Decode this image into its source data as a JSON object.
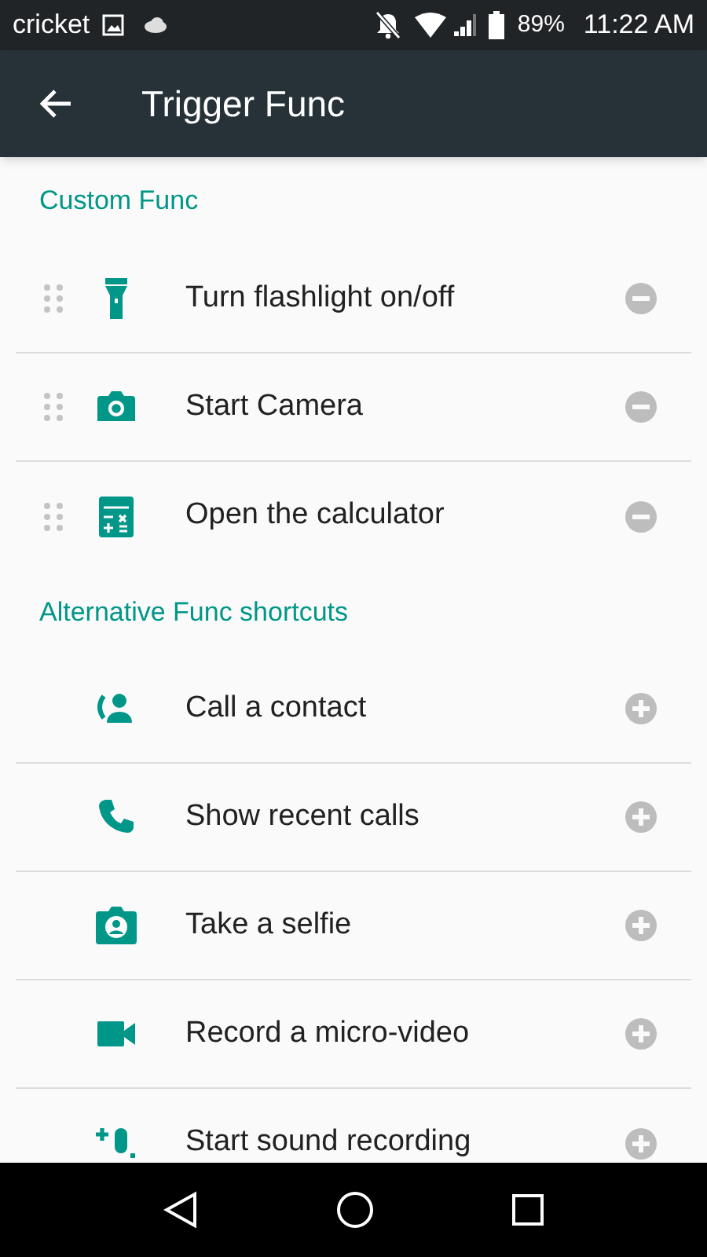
{
  "status_bar": {
    "carrier": "cricket",
    "battery": "89%",
    "time": "11:22 AM"
  },
  "app_bar": {
    "title": "Trigger Func"
  },
  "sections": [
    {
      "title": "Custom Func",
      "items": [
        {
          "kind": "removable",
          "label": "Turn flashlight on/off"
        },
        {
          "kind": "removable",
          "label": "Start Camera"
        },
        {
          "kind": "removable",
          "label": "Open the calculator"
        }
      ]
    },
    {
      "title": "Alternative Func shortcuts",
      "items": [
        {
          "kind": "addable",
          "label": "Call a contact"
        },
        {
          "kind": "addable",
          "label": "Show recent calls"
        },
        {
          "kind": "addable",
          "label": "Take a selfie"
        },
        {
          "kind": "addable",
          "label": "Record a micro-video"
        },
        {
          "kind": "addable",
          "label": "Start sound recording"
        }
      ]
    }
  ]
}
